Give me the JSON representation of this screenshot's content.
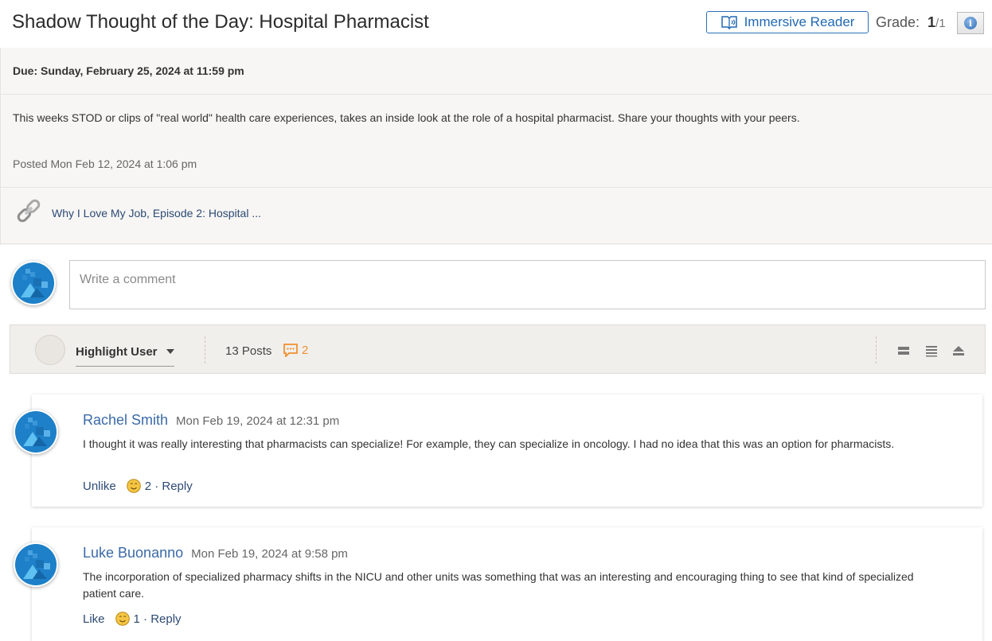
{
  "header": {
    "title": "Shadow Thought of the Day: Hospital Pharmacist",
    "immersive_reader_label": "Immersive Reader",
    "grade_label": "Grade:",
    "grade_value": "1",
    "grade_total": "/1"
  },
  "assignment": {
    "due": "Due: Sunday, February 25, 2024 at 11:59 pm",
    "description": "This weeks STOD or clips of \"real world\" health care experiences, takes an inside look at the role of a hospital pharmacist. Share your thoughts with your peers.",
    "posted": "Posted Mon Feb 12, 2024 at 1:06 pm",
    "attachment_link": "Why I Love My Job, Episode 2: Hospital ..."
  },
  "comment": {
    "placeholder": "Write a comment"
  },
  "toolbar": {
    "highlight_user_label": "Highlight User",
    "posts_count": "13 Posts",
    "unread_count": "2"
  },
  "posts": [
    {
      "author": "Rachel Smith",
      "date": "Mon Feb 19, 2024 at 12:31 pm",
      "body": "I thought it was really interesting that pharmacists can specialize! For example, they can specialize in oncology. I had no idea that this was an option for pharmacists.",
      "like_action": "Unlike",
      "likes": "2",
      "reply": "· Reply"
    },
    {
      "author": "Luke Buonanno",
      "date": "Mon Feb 19, 2024 at 9:58 pm",
      "body": "The incorporation of specialized pharmacy shifts in the NICU and other units was something that was an interesting and encouraging thing to see that kind of specialized patient care.",
      "like_action": "Like",
      "likes": "1",
      "reply": "· Reply"
    }
  ],
  "colors": {
    "accent_blue": "#2169b3",
    "author_blue": "#3b6aa8",
    "unread_orange": "#f0902f",
    "panel_bg": "#f7f6f4"
  }
}
